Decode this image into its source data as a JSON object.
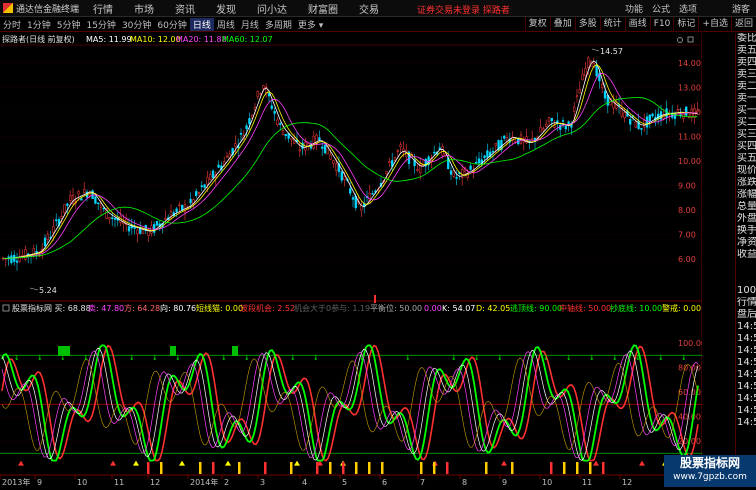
{
  "app": {
    "title": "通达信金融终端"
  },
  "menu": [
    "行情",
    "市场",
    "资讯",
    "发现",
    "问小达",
    "财富圈",
    "交易"
  ],
  "login_notice": "证券交易未登录 探路者",
  "menu_right": [
    "功能",
    "公式",
    "选项",
    "游客"
  ],
  "period_tabs": [
    "分时",
    "1分钟",
    "5分钟",
    "15分钟",
    "30分钟",
    "60分钟",
    "日线",
    "周线",
    "月线",
    "多周期",
    "更多"
  ],
  "active_tab": "日线",
  "tool_buttons": [
    "复权",
    "叠加",
    "多股",
    "统计",
    "画线",
    "F10",
    "标记",
    "+自选",
    "返回"
  ],
  "main_legend": {
    "stock": "探路者(日线 前复权)",
    "items": [
      {
        "text": "MA5: 11.99",
        "color": "#ffffff"
      },
      {
        "text": "MA10: 12.00",
        "color": "#ffff00"
      },
      {
        "text": "MA20: 11.88",
        "color": "#ff40ff"
      },
      {
        "text": "MA60: 12.07",
        "color": "#00ff00"
      }
    ]
  },
  "price_axis": [
    "14.00",
    "13.00",
    "12.00",
    "11.00",
    "10.00",
    "9.00",
    "8.00",
    "7.00",
    "6.00"
  ],
  "high_label": "14.57",
  "low_label": "5.24",
  "indicator_legend": {
    "items": [
      {
        "text": "股票指标网 买: 68.88",
        "color": "#e0e0e0"
      },
      {
        "text": "卖: 47.80",
        "color": "#ff40ff"
      },
      {
        "text": "方: 64.28",
        "color": "#ff6060"
      },
      {
        "text": "向: 80.76",
        "color": "#ffffff"
      },
      {
        "text": "短线猫: 0.00",
        "color": "#ffff00"
      },
      {
        "text": "波段机会: 2.52",
        "color": "#ff3030"
      },
      {
        "text": "机会大于0参与: 1.19",
        "color": "#606060"
      },
      {
        "text": "平衡位: 50.00",
        "color": "#a0a0a0"
      },
      {
        "text": "0.00",
        "color": "#ff40ff"
      },
      {
        "text": "K: 54.07",
        "color": "#ffffff"
      },
      {
        "text": "D: 42.05",
        "color": "#ffff00"
      },
      {
        "text": "逃顶线: 90.00",
        "color": "#00ff00"
      },
      {
        "text": "中轴线: 50.00",
        "color": "#ff3030"
      },
      {
        "text": "抄底线: 10.00",
        "color": "#00ff00"
      },
      {
        "text": "警戒: 0.00",
        "color": "#ffff00"
      }
    ]
  },
  "indicator_axis": [
    "100.00",
    "80.00",
    "60.00",
    "40.00",
    "20.00"
  ],
  "date_axis": [
    "2013年",
    "9",
    "10",
    "11",
    "12",
    "2014年",
    "2",
    "3",
    "4",
    "5",
    "6",
    "7",
    "8",
    "9",
    "10",
    "11",
    "12"
  ],
  "sidebar": {
    "top": [
      "委比",
      "卖五",
      "卖四",
      "卖三",
      "卖二",
      "卖一",
      "买一",
      "买二",
      "买三",
      "买四",
      "买五",
      "现价",
      "涨跌",
      "涨幅",
      "总量",
      "外盘",
      "换手",
      "净资",
      "收益"
    ],
    "bottom": [
      "100",
      "行情",
      "盘后",
      "14:5",
      "14:5",
      "14:5",
      "14:5",
      "14:5",
      "14:5",
      "14:5",
      "14:5",
      "14:5"
    ]
  },
  "watermark": {
    "title": "股票指标网",
    "url": "www.7gpzb.com"
  }
}
